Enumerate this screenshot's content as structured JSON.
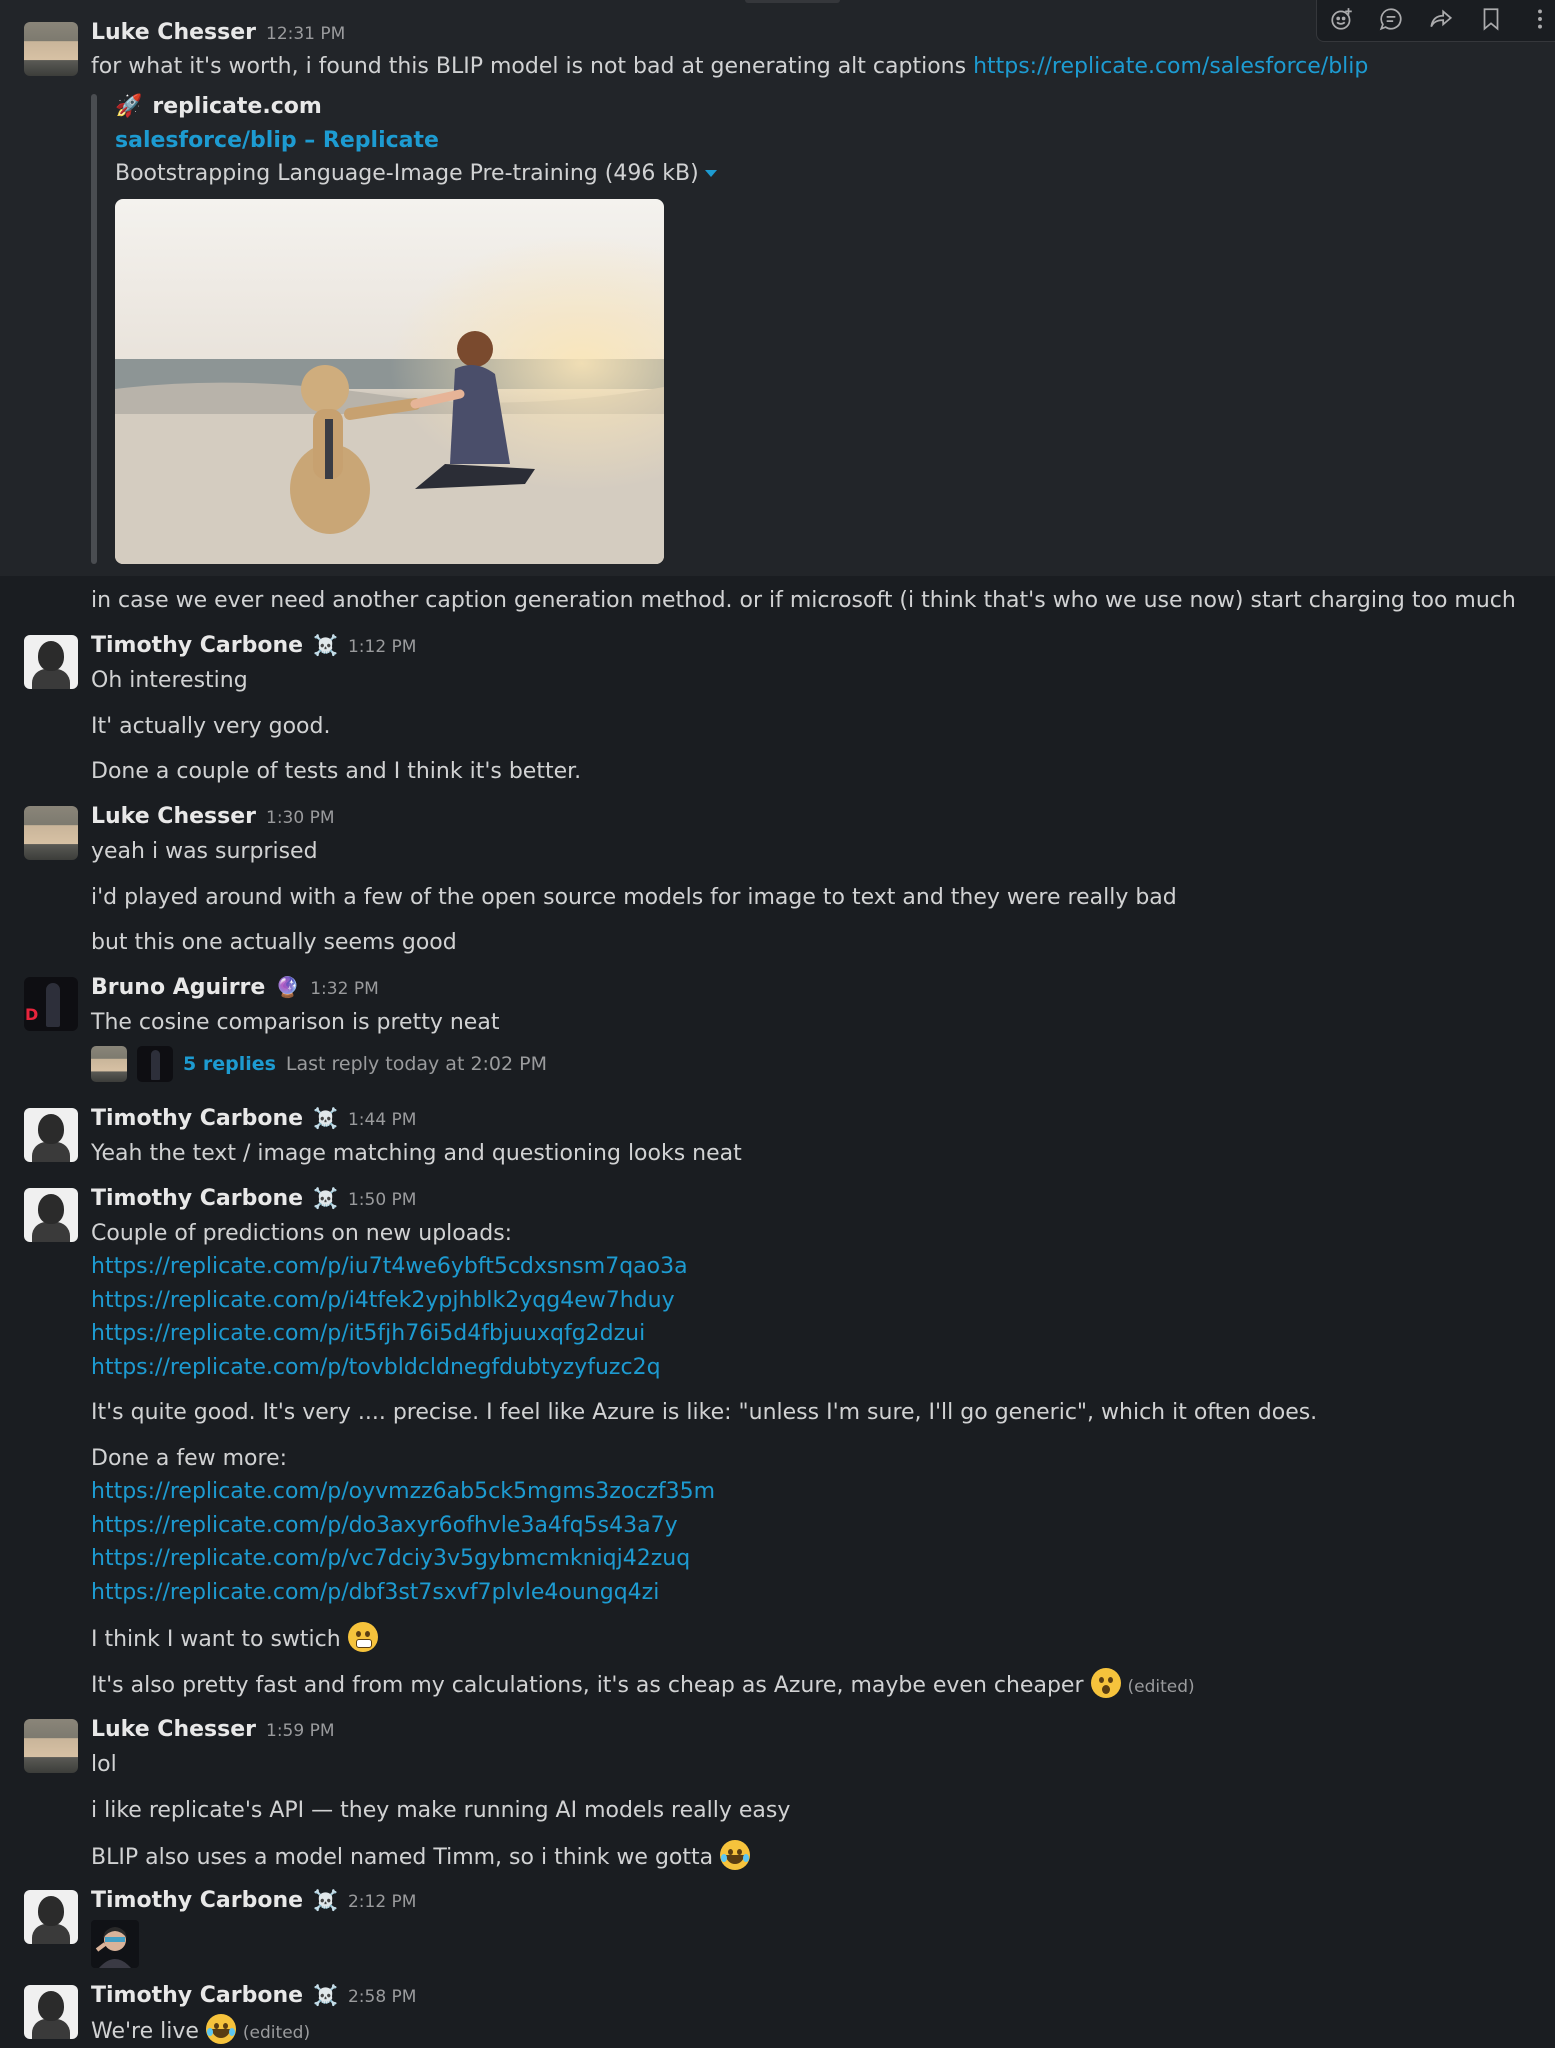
{
  "toolbar": {
    "icons": [
      "add-reaction-icon",
      "reply-in-thread-icon",
      "share-icon",
      "bookmark-icon",
      "more-actions-icon"
    ]
  },
  "messages": [
    {
      "author": "Luke Chesser",
      "time": "12:31 PM",
      "text": "for what it's worth, i found this BLIP model is not bad at generating alt captions",
      "link": "https://replicate.com/salesforce/blip",
      "unfurl": {
        "site": "replicate.com",
        "title": "salesforce/blip – Replicate",
        "description": "Bootstrapping Language-Image Pre-training (496 kB)"
      },
      "followup": "in case we ever need another caption generation method. or if microsoft (i think that's who we use now) start charging too much"
    },
    {
      "author": "Timothy Carbone",
      "status": "☠️",
      "time": "1:12 PM",
      "lines": [
        "Oh interesting",
        "It' actually very good.",
        "Done a couple of tests and I think it's better."
      ]
    },
    {
      "author": "Luke Chesser",
      "time": "1:30 PM",
      "lines": [
        "yeah i was surprised",
        "i'd played around with a few of the open source models for image to text and they were really bad",
        "but this one actually seems good"
      ]
    },
    {
      "author": "Bruno Aguirre",
      "status": "🔮",
      "time": "1:32 PM",
      "text": "The cosine comparison is pretty neat",
      "thread": {
        "replies": "5 replies",
        "last_reply": "Last reply today at 2:02 PM"
      }
    },
    {
      "author": "Timothy Carbone",
      "status": "☠️",
      "time": "1:44 PM",
      "text": "Yeah the text / image matching and questioning looks neat"
    },
    {
      "author": "Timothy Carbone",
      "status": "☠️",
      "time": "1:50 PM",
      "intro": "Couple of predictions on new uploads:",
      "links1": [
        "https://replicate.com/p/iu7t4we6ybft5cdxsnsm7qao3a",
        "https://replicate.com/p/i4tfek2ypjhblk2yqg4ew7hduy",
        "https://replicate.com/p/it5fjh76i5d4fbjuuxqfg2dzui",
        "https://replicate.com/p/tovbldcldnegfdubtyzyfuzc2q"
      ],
      "comment": "It's quite good. It's very .... precise. I feel like Azure is like: \"unless I'm sure, I'll go generic\", which it often does.",
      "intro2": "Done a few more:",
      "links2": [
        "https://replicate.com/p/oyvmzz6ab5ck5mgms3zoczf35m",
        "https://replicate.com/p/do3axyr6ofhvle3a4fq5s43a7y",
        "https://replicate.com/p/vc7dciy3v5gybmcmkniqj42zuq",
        "https://replicate.com/p/dbf3st7sxvf7plvle4oungq4zi"
      ],
      "switch": "I think I want to swtich",
      "fast": "It's also pretty fast and from my calculations, it's as cheap as Azure, maybe even cheaper",
      "edited": "(edited)"
    },
    {
      "author": "Luke Chesser",
      "time": "1:59 PM",
      "lines": [
        "lol",
        "i like replicate's API — they make running AI models really easy",
        "BLIP also uses a model named Timm, so i think we gotta"
      ]
    },
    {
      "author": "Timothy Carbone",
      "status": "☠️",
      "time": "2:12 PM"
    },
    {
      "author": "Timothy Carbone",
      "status": "☠️",
      "time": "2:58 PM",
      "text": "We're live",
      "edited": "(edited)"
    }
  ]
}
